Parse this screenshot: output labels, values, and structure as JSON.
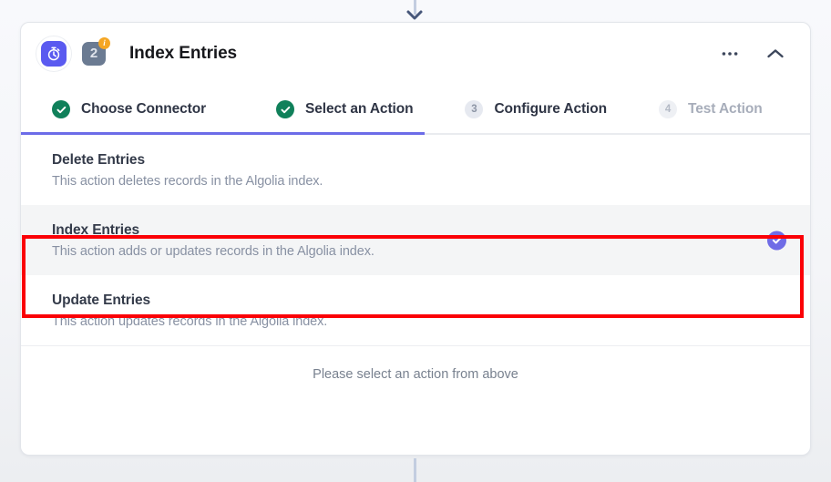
{
  "card": {
    "title": "Index Entries",
    "app_icon": "stopwatch-icon",
    "step_number": "2",
    "step_info_badge": "i",
    "menu_icon": "ellipsis-icon",
    "collapse_icon": "chevron-up-icon"
  },
  "tabs": [
    {
      "label": "Choose Connector",
      "state": "complete",
      "marker": "check"
    },
    {
      "label": "Select an Action",
      "state": "complete",
      "marker": "check"
    },
    {
      "label": "Configure Action",
      "state": "upcoming",
      "marker": "3"
    },
    {
      "label": "Test Action",
      "state": "disabled",
      "marker": "4"
    }
  ],
  "actions": [
    {
      "title": "Delete Entries",
      "description": "This action deletes records in the Algolia index.",
      "selected": false
    },
    {
      "title": "Index Entries",
      "description": "This action adds or updates records in the Algolia index.",
      "selected": true
    },
    {
      "title": "Update Entries",
      "description": "This action updates records in the Algolia index.",
      "selected": false
    }
  ],
  "footer": {
    "message": "Please select an action from above"
  },
  "colors": {
    "accent_purple": "#6c6ce8",
    "complete_green": "#10805a",
    "annotation_red": "#fb0006",
    "info_orange": "#f5a623"
  }
}
